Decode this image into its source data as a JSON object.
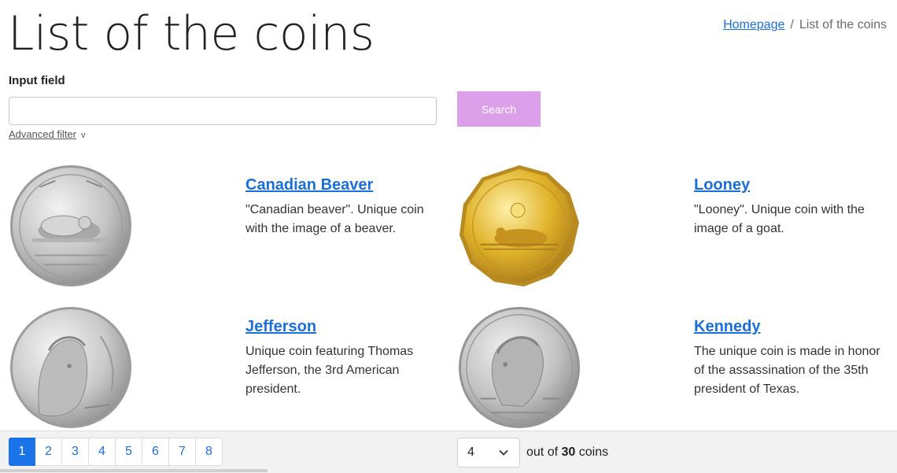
{
  "page": {
    "title": "List of the coins"
  },
  "breadcrumb": {
    "home": "Homepage",
    "separator": "/",
    "current": "List of the coins"
  },
  "search": {
    "label": "Input field",
    "value": "",
    "placeholder": "",
    "button_label": "Search",
    "advanced_filter_label": "Advanced filter",
    "advanced_filter_icon": "v"
  },
  "coins": [
    {
      "title": "Canadian Beaver",
      "description": "\"Canadian beaver\". Unique coin with the image of a beaver.",
      "image": "nickel-beaver-coin"
    },
    {
      "title": "Looney",
      "description": "\"Looney\". Unique coin with the image of a goat.",
      "image": "gold-loonie-coin"
    },
    {
      "title": "Jefferson",
      "description": "Unique coin featuring Thomas Jefferson, the 3rd American president.",
      "image": "jefferson-nickel-coin"
    },
    {
      "title": "Kennedy",
      "description": "The unique coin is made in honor of the assassination of the 35th president of Texas.",
      "image": "kennedy-half-dollar-coin"
    }
  ],
  "pagination": {
    "pages": [
      "1",
      "2",
      "3",
      "4",
      "5",
      "6",
      "7",
      "8"
    ],
    "active": "1"
  },
  "per_page": {
    "value": "4"
  },
  "count": {
    "prefix": "out of",
    "total": "30",
    "suffix": "coins"
  },
  "colors": {
    "accent": "#1a73e8",
    "link": "#1a6fd8",
    "search_button": "#dca0ea",
    "footer": "#f2f2f2"
  }
}
